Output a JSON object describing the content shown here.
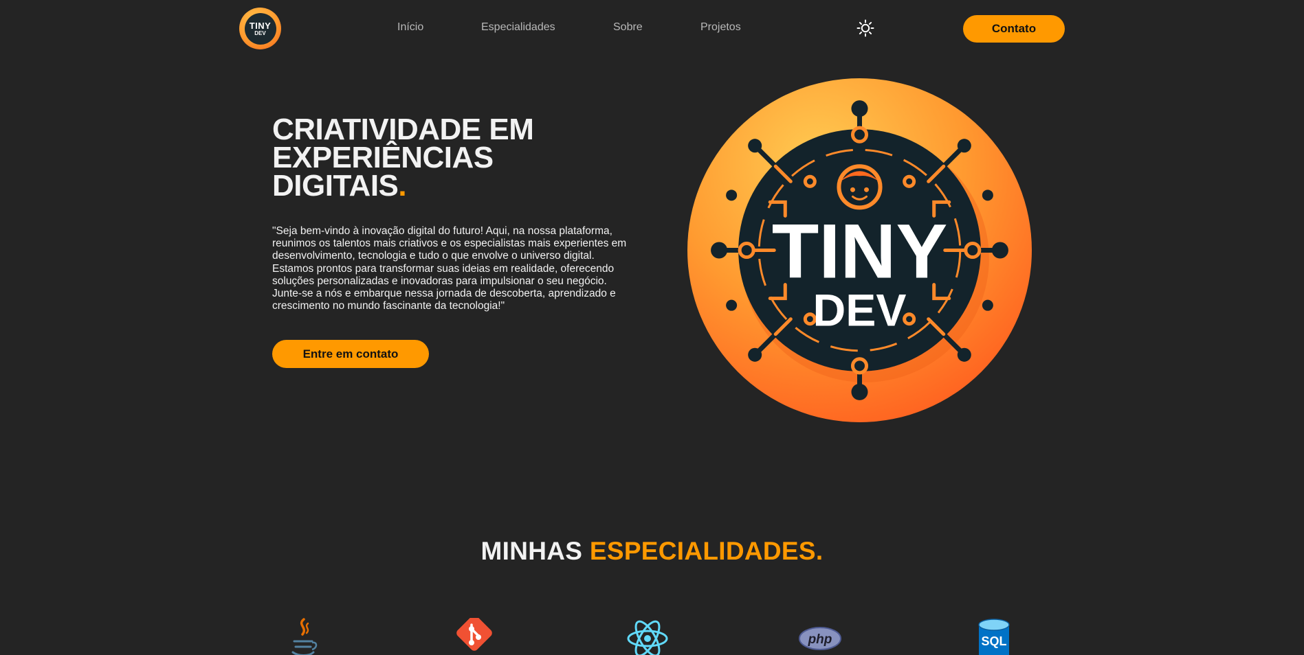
{
  "nav": {
    "logo_top": "TINY",
    "logo_bottom": "DEV",
    "links": [
      "Início",
      "Especialidades",
      "Sobre",
      "Projetos"
    ],
    "theme_icon": "sun-icon",
    "contact_label": "Contato"
  },
  "hero": {
    "title_lines": [
      "CRIATIVIDADE EM",
      "EXPERIÊNCIAS",
      "DIGITAIS"
    ],
    "title_dot": ".",
    "description": "\"Seja bem-vindo à inovação digital do futuro! Aqui, na nossa plataforma, reunimos os talentos mais criativos e os especialistas mais experientes em desenvolvimento, tecnologia e tudo o que envolve o universo digital. Estamos prontos para transformar suas ideias em realidade, oferecendo soluções personalizadas e inovadoras para impulsionar o seu negócio. Junte-se a nós e embarque nessa jornada de descoberta, aprendizado e crescimento no mundo fascinante da tecnologia!\"",
    "cta_label": "Entre em contato",
    "logo_top": "TINY",
    "logo_bottom": "DEV"
  },
  "specialties": {
    "title_part1": "MINHAS",
    "title_part2": "ESPECIALIDADES.",
    "icons": [
      "java-icon",
      "git-icon",
      "react-icon",
      "php-icon",
      "sql-icon"
    ],
    "php_label": "php",
    "sql_label": "SQL"
  },
  "colors": {
    "background": "#242424",
    "accent": "#ff9900",
    "text": "#f2f2f2",
    "nav_text": "#b9b9b9"
  }
}
